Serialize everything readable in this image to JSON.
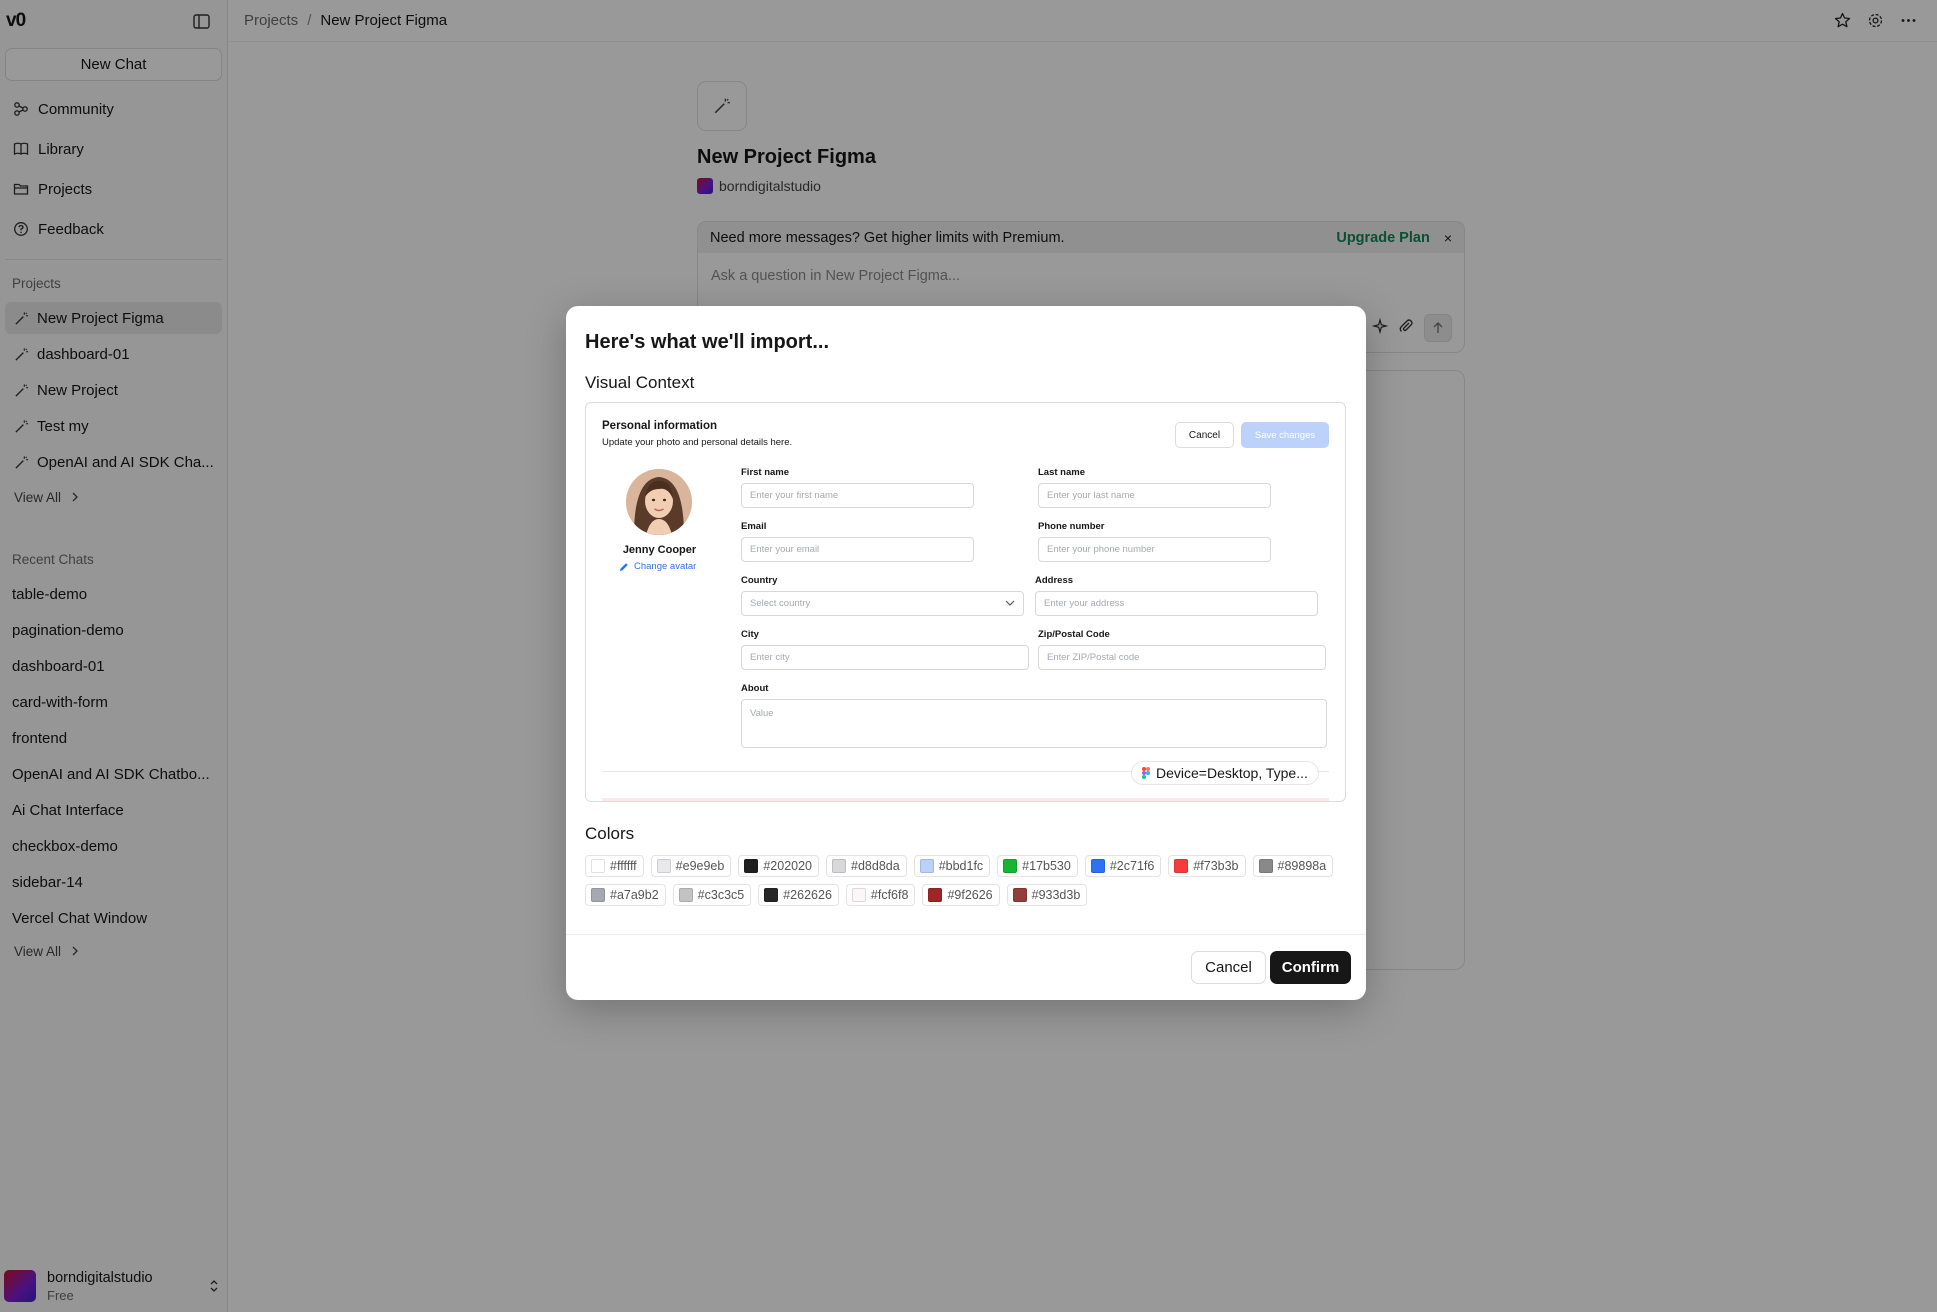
{
  "app": {
    "logo": "v0"
  },
  "sidebar": {
    "new_chat": "New Chat",
    "nav": [
      {
        "label": "Community",
        "icon": "community-icon"
      },
      {
        "label": "Library",
        "icon": "book-icon"
      },
      {
        "label": "Projects",
        "icon": "folder-icon"
      },
      {
        "label": "Feedback",
        "icon": "help-circle-icon"
      }
    ],
    "projects_label": "Projects",
    "projects": [
      "New Project Figma",
      "dashboard-01",
      "New Project",
      "Test my",
      "OpenAI and AI SDK Cha..."
    ],
    "view_all": "View All",
    "recent_label": "Recent Chats",
    "recent": [
      "table-demo",
      "pagination-demo",
      "dashboard-01",
      "card-with-form",
      "frontend",
      "OpenAI and AI SDK Chatbo...",
      "Ai Chat Interface",
      "checkbox-demo",
      "sidebar-14",
      "Vercel Chat Window"
    ],
    "user": {
      "name": "borndigitalstudio",
      "plan": "Free"
    }
  },
  "header": {
    "breadcrumb_root": "Projects",
    "breadcrumb_sep": "/",
    "breadcrumb_current": "New Project Figma"
  },
  "project": {
    "title": "New Project Figma",
    "owner": "borndigitalstudio",
    "promo_text": "Need more messages? Get higher limits with Premium.",
    "upgrade_label": "Upgrade Plan",
    "close_glyph": "×",
    "composer_placeholder": "Ask a question in New Project Figma..."
  },
  "modal": {
    "title": "Here's what we'll import...",
    "visual_context_label": "Visual Context",
    "preview": {
      "heading": "Personal information",
      "subheading": "Update your photo and personal details here.",
      "cancel": "Cancel",
      "save": "Save changes",
      "name": "Jenny Cooper",
      "change_avatar": "Change avatar",
      "fields": {
        "first_name": {
          "label": "First name",
          "placeholder": "Enter your first name"
        },
        "last_name": {
          "label": "Last name",
          "placeholder": "Enter your last name"
        },
        "email": {
          "label": "Email",
          "placeholder": "Enter your email"
        },
        "phone": {
          "label": "Phone number",
          "placeholder": "Enter your phone number"
        },
        "country": {
          "label": "Country",
          "placeholder": "Select country"
        },
        "address": {
          "label": "Address",
          "placeholder": "Enter your address"
        },
        "city": {
          "label": "City",
          "placeholder": "Enter city"
        },
        "zip": {
          "label": "Zip/Postal Code",
          "placeholder": "Enter ZIP/Postal code"
        },
        "about": {
          "label": "About",
          "placeholder": "Value"
        }
      },
      "frame_tag": "Device=Desktop, Type..."
    },
    "colors_label": "Colors",
    "colors": [
      "#ffffff",
      "#e9e9eb",
      "#202020",
      "#d8d8da",
      "#bbd1fc",
      "#17b530",
      "#2c71f6",
      "#f73b3b",
      "#89898a",
      "#a7a9b2",
      "#c3c3c5",
      "#262626",
      "#fcf6f8",
      "#9f2626",
      "#933d3b"
    ],
    "cancel_label": "Cancel",
    "confirm_label": "Confirm"
  }
}
